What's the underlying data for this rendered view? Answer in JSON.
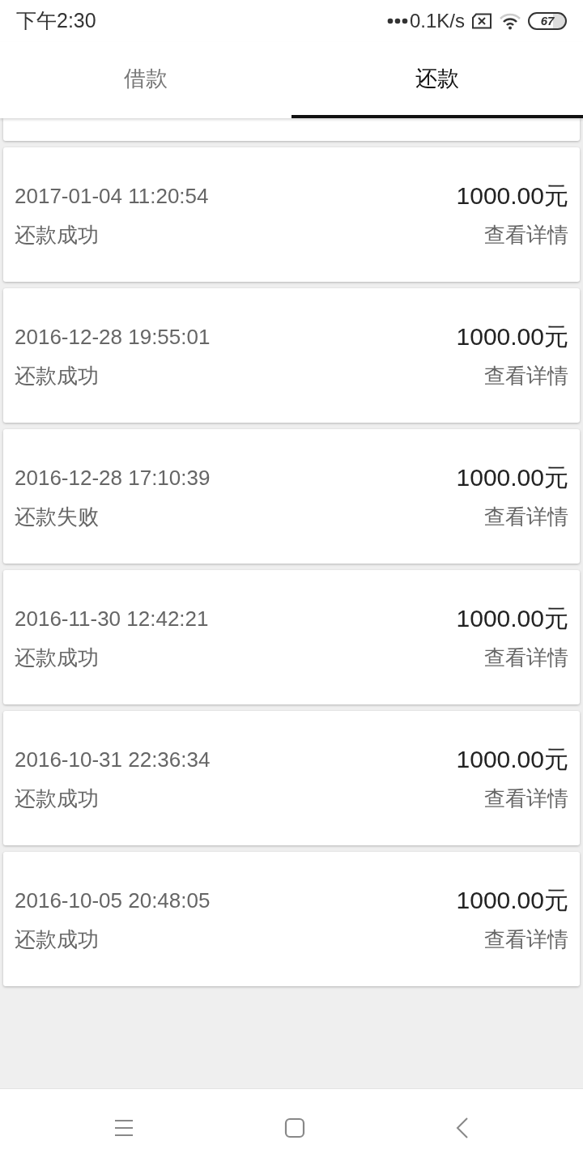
{
  "status_bar": {
    "time": "下午2:30",
    "speed": "0.1K/s",
    "battery": "67"
  },
  "tabs": [
    {
      "label": "借款",
      "selected": false
    },
    {
      "label": "还款",
      "selected": true
    }
  ],
  "records": [
    {
      "time": "2017-01-04 11:20:54",
      "status": "还款成功",
      "amount": "1000.00元",
      "link": "查看详情"
    },
    {
      "time": "2016-12-28 19:55:01",
      "status": "还款成功",
      "amount": "1000.00元",
      "link": "查看详情"
    },
    {
      "time": "2016-12-28 17:10:39",
      "status": "还款失败",
      "amount": "1000.00元",
      "link": "查看详情"
    },
    {
      "time": "2016-11-30 12:42:21",
      "status": "还款成功",
      "amount": "1000.00元",
      "link": "查看详情"
    },
    {
      "time": "2016-10-31 22:36:34",
      "status": "还款成功",
      "amount": "1000.00元",
      "link": "查看详情"
    },
    {
      "time": "2016-10-05 20:48:05",
      "status": "还款成功",
      "amount": "1000.00元",
      "link": "查看详情"
    }
  ]
}
